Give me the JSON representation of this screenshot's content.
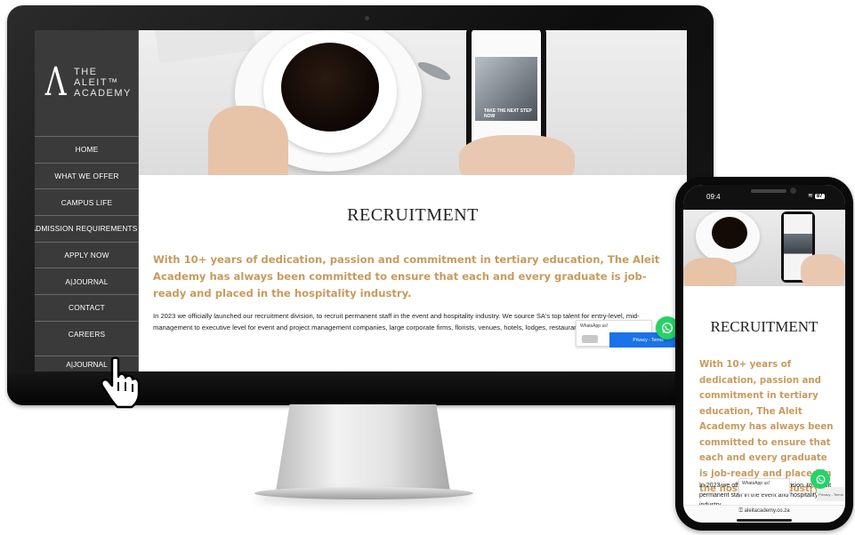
{
  "desktop": {
    "logo": {
      "mark": "Λ",
      "line1": "THE",
      "line2": "ALEIT™",
      "line3": "ACADEMY"
    },
    "nav": [
      {
        "label": "HOME"
      },
      {
        "label": "WHAT WE OFFER"
      },
      {
        "label": "CAMPUS LIFE"
      },
      {
        "label": "ADMISSION REQUIREMENTS"
      },
      {
        "label": "APPLY NOW"
      },
      {
        "label": "A|JOURNAL"
      },
      {
        "label": "CONTACT"
      },
      {
        "label": "CAREERS"
      }
    ],
    "nav_bottom": "A|JOURNAL",
    "hero_phone_cta": "TAKE THE NEXT STEP NOW",
    "title": "RECRUITMENT",
    "lead": "With 10+ years of dedication, passion and commitment in tertiary education, The Aleit Academy has always been committed to ensure that each and every graduate is job-ready and placed in the hospitality industry.",
    "body": "In 2023 we officially launched our recruitment division, to recruit permanent staff in the event and hospitality industry. We source SA's top talent for entry-level, mid-management to executive level for event and project management companies, large corporate firms, florists, venues, hotels, lodges, restaurants, and allied industries.",
    "whatsapp_popup": "WhatsApp us!",
    "recaptcha": "Privacy - Terms"
  },
  "mobile": {
    "status_time": "09:4",
    "battery": "87",
    "title": "RECRUITMENT",
    "lead": "With 10+ years of dedication, passion and commitment in tertiary education, The Aleit Academy has always been committed to ensure that each and every graduate is job-ready and placed in the hospitality industry.",
    "body": "In 2023 we offic... recruitment division, to recruit permanent staff in the event and hospitality industry",
    "whatsapp_popup": "WhatsApp us!",
    "recaptcha": "Privacy - Terms",
    "url": "aleitacademy.co.za"
  },
  "colors": {
    "accent_gold": "#c89a5c",
    "sidebar": "#3a3a3a",
    "whatsapp": "#25d366",
    "recaptcha_blue": "#1a73e8"
  }
}
